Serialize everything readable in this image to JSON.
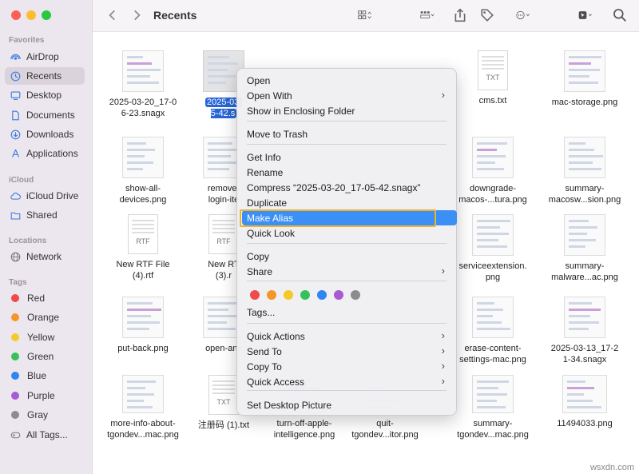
{
  "toolbar": {
    "title": "Recents"
  },
  "sidebar": {
    "favorites_heading": "Favorites",
    "favorites": [
      {
        "label": "AirDrop"
      },
      {
        "label": "Recents"
      },
      {
        "label": "Desktop"
      },
      {
        "label": "Documents"
      },
      {
        "label": "Downloads"
      },
      {
        "label": "Applications"
      }
    ],
    "icloud_heading": "iCloud",
    "icloud": [
      {
        "label": "iCloud Drive"
      },
      {
        "label": "Shared"
      }
    ],
    "locations_heading": "Locations",
    "locations": [
      {
        "label": "Network"
      }
    ],
    "tags_heading": "Tags",
    "tags": [
      {
        "label": "Red",
        "color": "#ef4b4b"
      },
      {
        "label": "Orange",
        "color": "#f5962a"
      },
      {
        "label": "Yellow",
        "color": "#f5c92a"
      },
      {
        "label": "Green",
        "color": "#38c15b"
      },
      {
        "label": "Blue",
        "color": "#2f86f0"
      },
      {
        "label": "Purple",
        "color": "#a65bd4"
      },
      {
        "label": "Gray",
        "color": "#8c8c90"
      },
      {
        "label": "All Tags..."
      }
    ]
  },
  "files": [
    {
      "label": "2025-03-20_17-0\n6-23.snagx"
    },
    {
      "label": "2025-03-\n5-42.s"
    },
    {
      "label": "cms.txt",
      "ext": "TXT"
    },
    {
      "label": "mac-storage.png"
    },
    {
      "label": "show-all-\ndevices.png"
    },
    {
      "label": "remove-\nlogin-ite"
    },
    {
      "label": "downgrade-\nmacos-...tura.png"
    },
    {
      "label": "summary-\nmacosw...sion.png"
    },
    {
      "label": "New RTF File\n(4).rtf",
      "ext": "RTF"
    },
    {
      "label": "New RT\n(3).r",
      "ext": "RTF"
    },
    {
      "label": "serviceextension.\npng"
    },
    {
      "label": "summary-\nmalware...ac.png"
    },
    {
      "label": "put-back.png"
    },
    {
      "label": "open-any"
    },
    {
      "label": "erase-content-\nsettings-mac.png"
    },
    {
      "label": "2025-03-13_17-2\n1-34.snagx"
    },
    {
      "label": "more-info-about-\ntgondev...mac.png"
    },
    {
      "label": "注册码 (1).txt",
      "ext": "TXT"
    },
    {
      "label": "turn-off-apple-\nintelligence.png"
    },
    {
      "label": "quit-\ntgondev...itor.png"
    },
    {
      "label": "summary-\ntgondev...mac.png"
    },
    {
      "label": "11494033.png"
    }
  ],
  "menu": {
    "items": [
      {
        "label": "Open"
      },
      {
        "label": "Open With"
      },
      {
        "label": "Show in Enclosing Folder"
      },
      {
        "label": "Move to Trash"
      },
      {
        "label": "Get Info"
      },
      {
        "label": "Rename"
      },
      {
        "label": "Compress “2025-03-20_17-05-42.snagx”"
      },
      {
        "label": "Duplicate"
      },
      {
        "label": "Make Alias"
      },
      {
        "label": "Quick Look"
      },
      {
        "label": "Copy"
      },
      {
        "label": "Share"
      },
      {
        "label": "Tags..."
      },
      {
        "label": "Quick Actions"
      },
      {
        "label": "Send To"
      },
      {
        "label": "Copy To"
      },
      {
        "label": "Quick Access"
      },
      {
        "label": "Set Desktop Picture"
      }
    ],
    "tag_colors": [
      "#ef4b4b",
      "#f5962a",
      "#f5c92a",
      "#38c15b",
      "#2f86f0",
      "#a65bd4",
      "#8c8c90"
    ],
    "highlight_color": "#3b8ff5",
    "callout_color": "#f0b330"
  },
  "watermark": "wsxdn.com"
}
